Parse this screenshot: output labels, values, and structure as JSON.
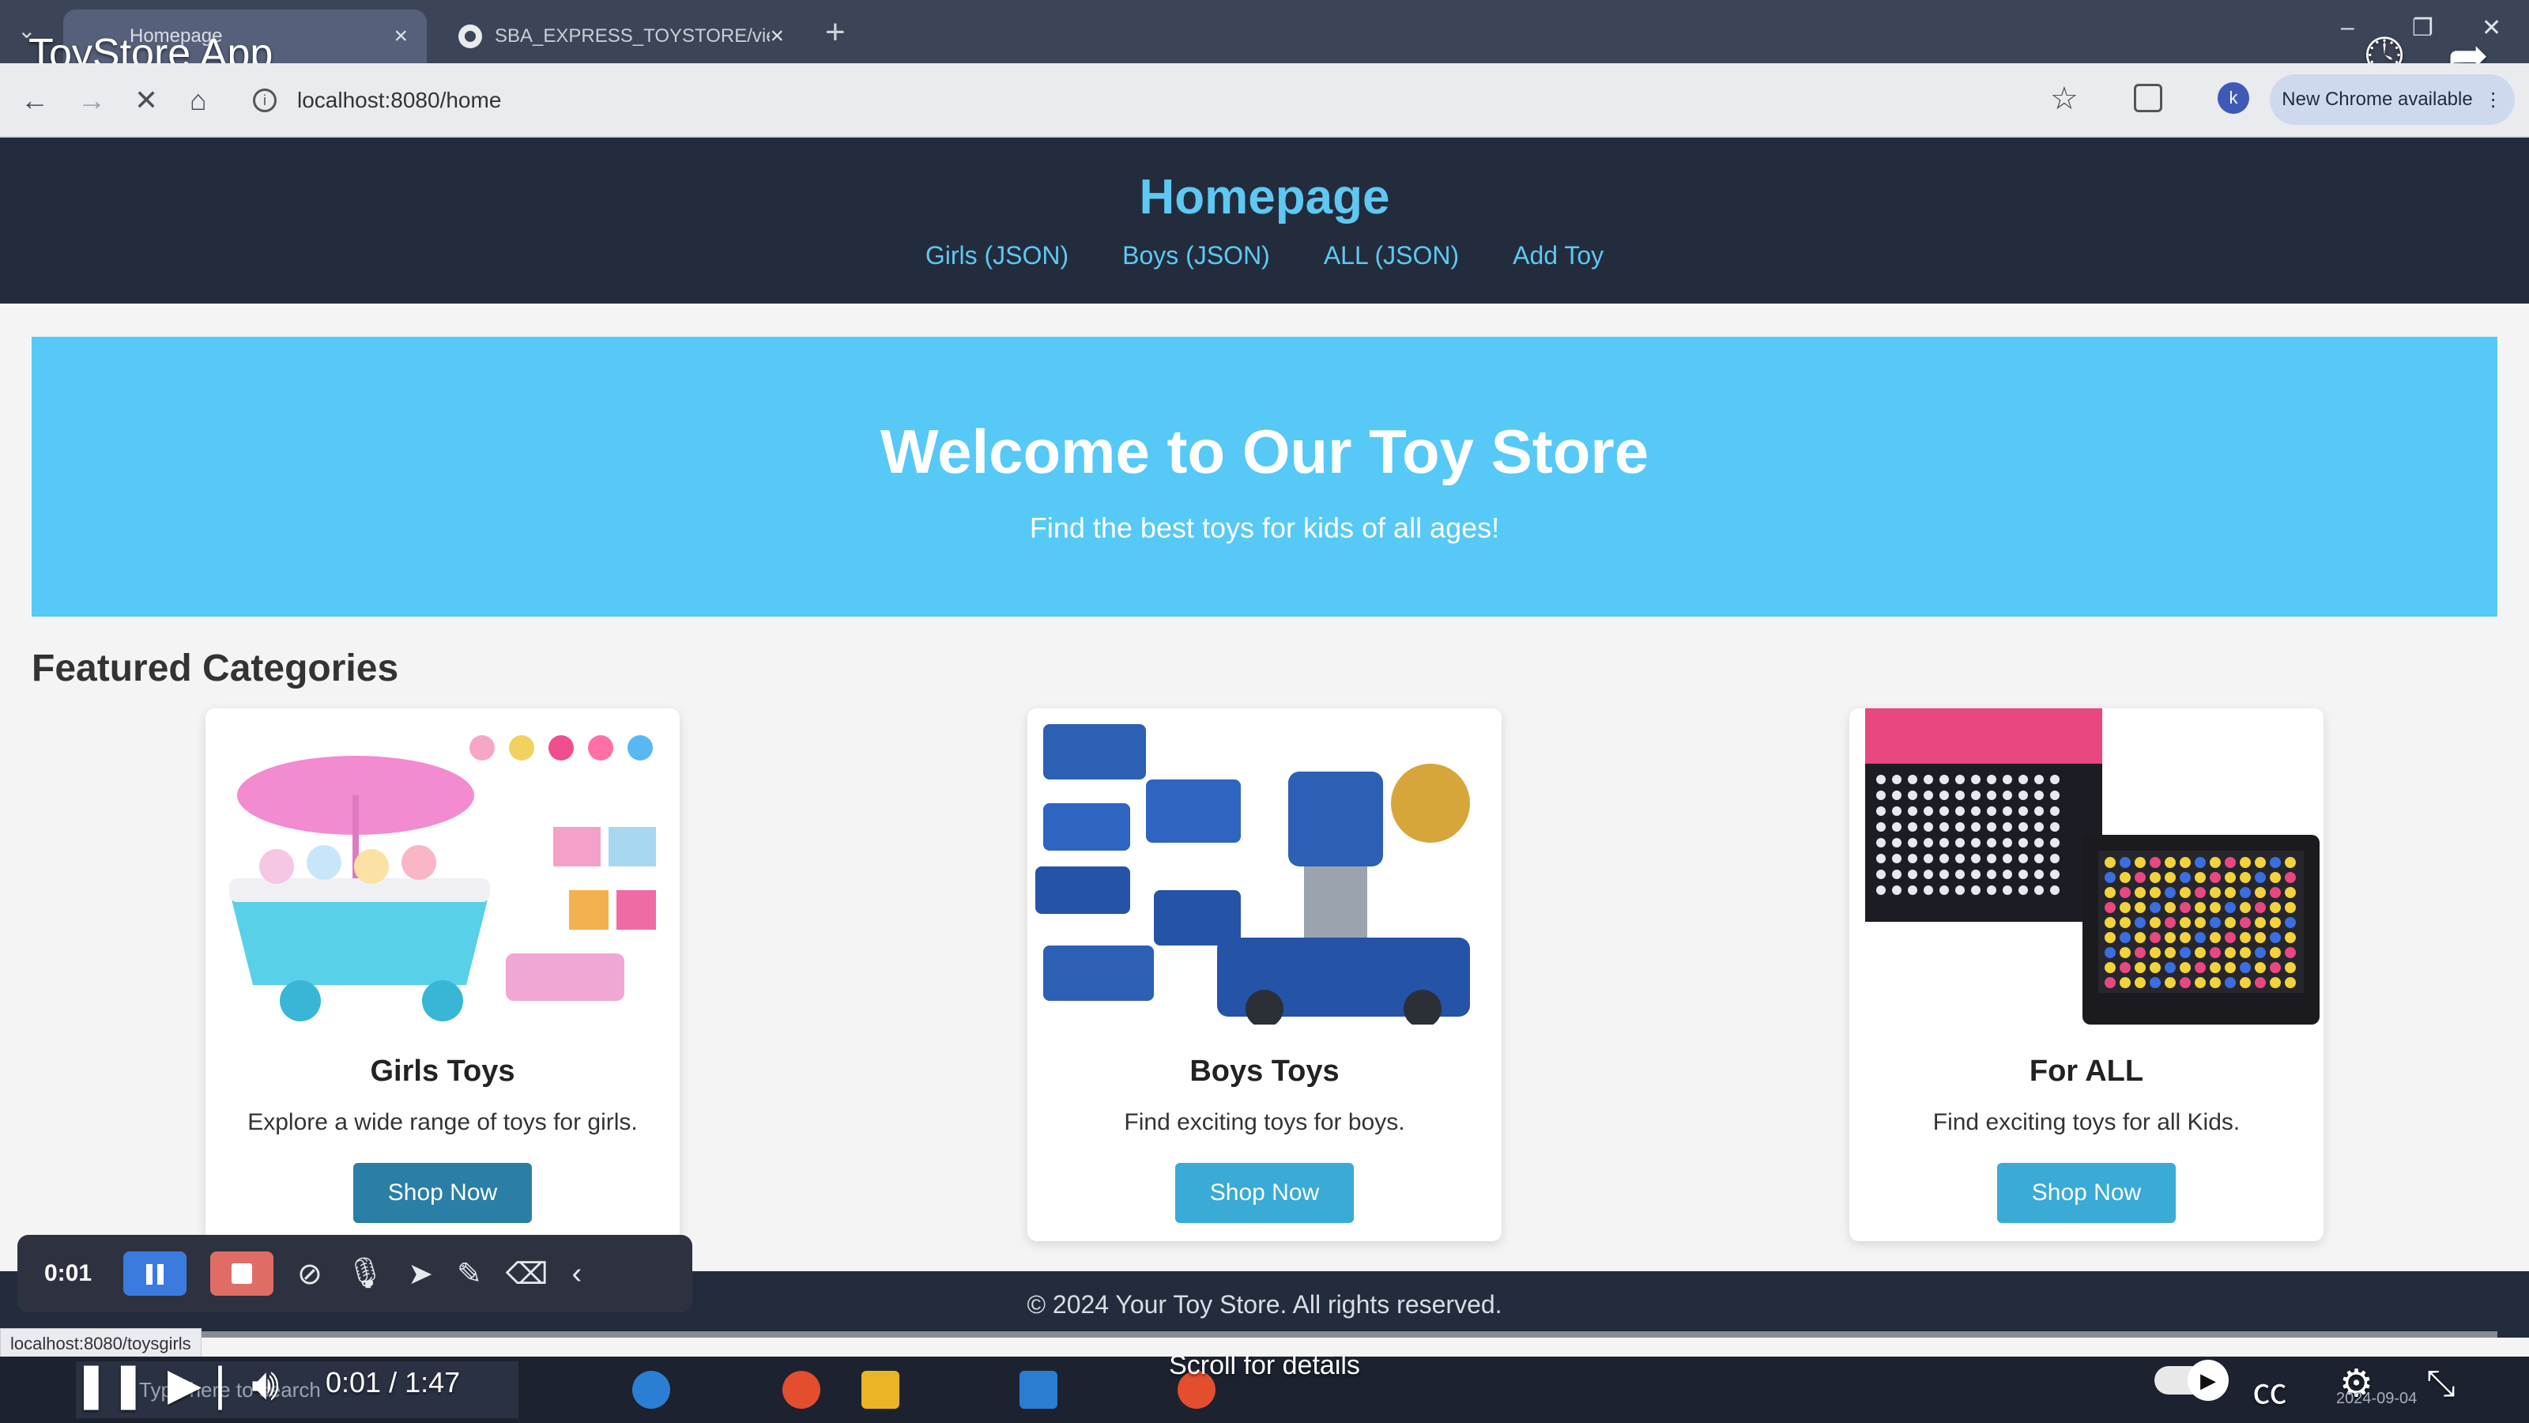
{
  "browser": {
    "tabs": [
      {
        "label": "Homepage",
        "active": true
      },
      {
        "label": "SBA_EXPRESS_TOYSTORE/view",
        "active": false
      }
    ],
    "url": "localhost:8080/home",
    "profile_initial": "k",
    "update_label": "New Chrome available"
  },
  "video": {
    "title": "ToyStore App",
    "time": "0:01 / 1:47",
    "progress_fraction": 0.006,
    "scroll_hint": "Scroll for details"
  },
  "site": {
    "title": "Homepage",
    "nav": [
      "Girls (JSON)",
      "Boys (JSON)",
      "ALL (JSON)",
      "Add Toy"
    ],
    "hero": {
      "heading": "Welcome to Our Toy Store",
      "subheading": "Find the best toys for kids of all ages!",
      "color": "#56c9f6"
    },
    "featured_title": "Featured Categories",
    "categories": [
      {
        "title": "Girls Toys",
        "description": "Explore a wide range of toys for girls.",
        "button": "Shop Now"
      },
      {
        "title": "Boys Toys",
        "description": "Find exciting toys for boys.",
        "button": "Shop Now"
      },
      {
        "title": "For ALL",
        "description": "Find exciting toys for all Kids.",
        "button": "Shop Now"
      }
    ],
    "footer": "© 2024 Your Toy Store. All rights reserved.",
    "header_color": "#232c3d",
    "accent_color": "#5ec8f2"
  },
  "recorder": {
    "time": "0:01"
  },
  "status_url": "localhost:8080/toysgirls",
  "taskbar": {
    "search_placeholder": "Type here to search",
    "date": "2024-09-04"
  }
}
